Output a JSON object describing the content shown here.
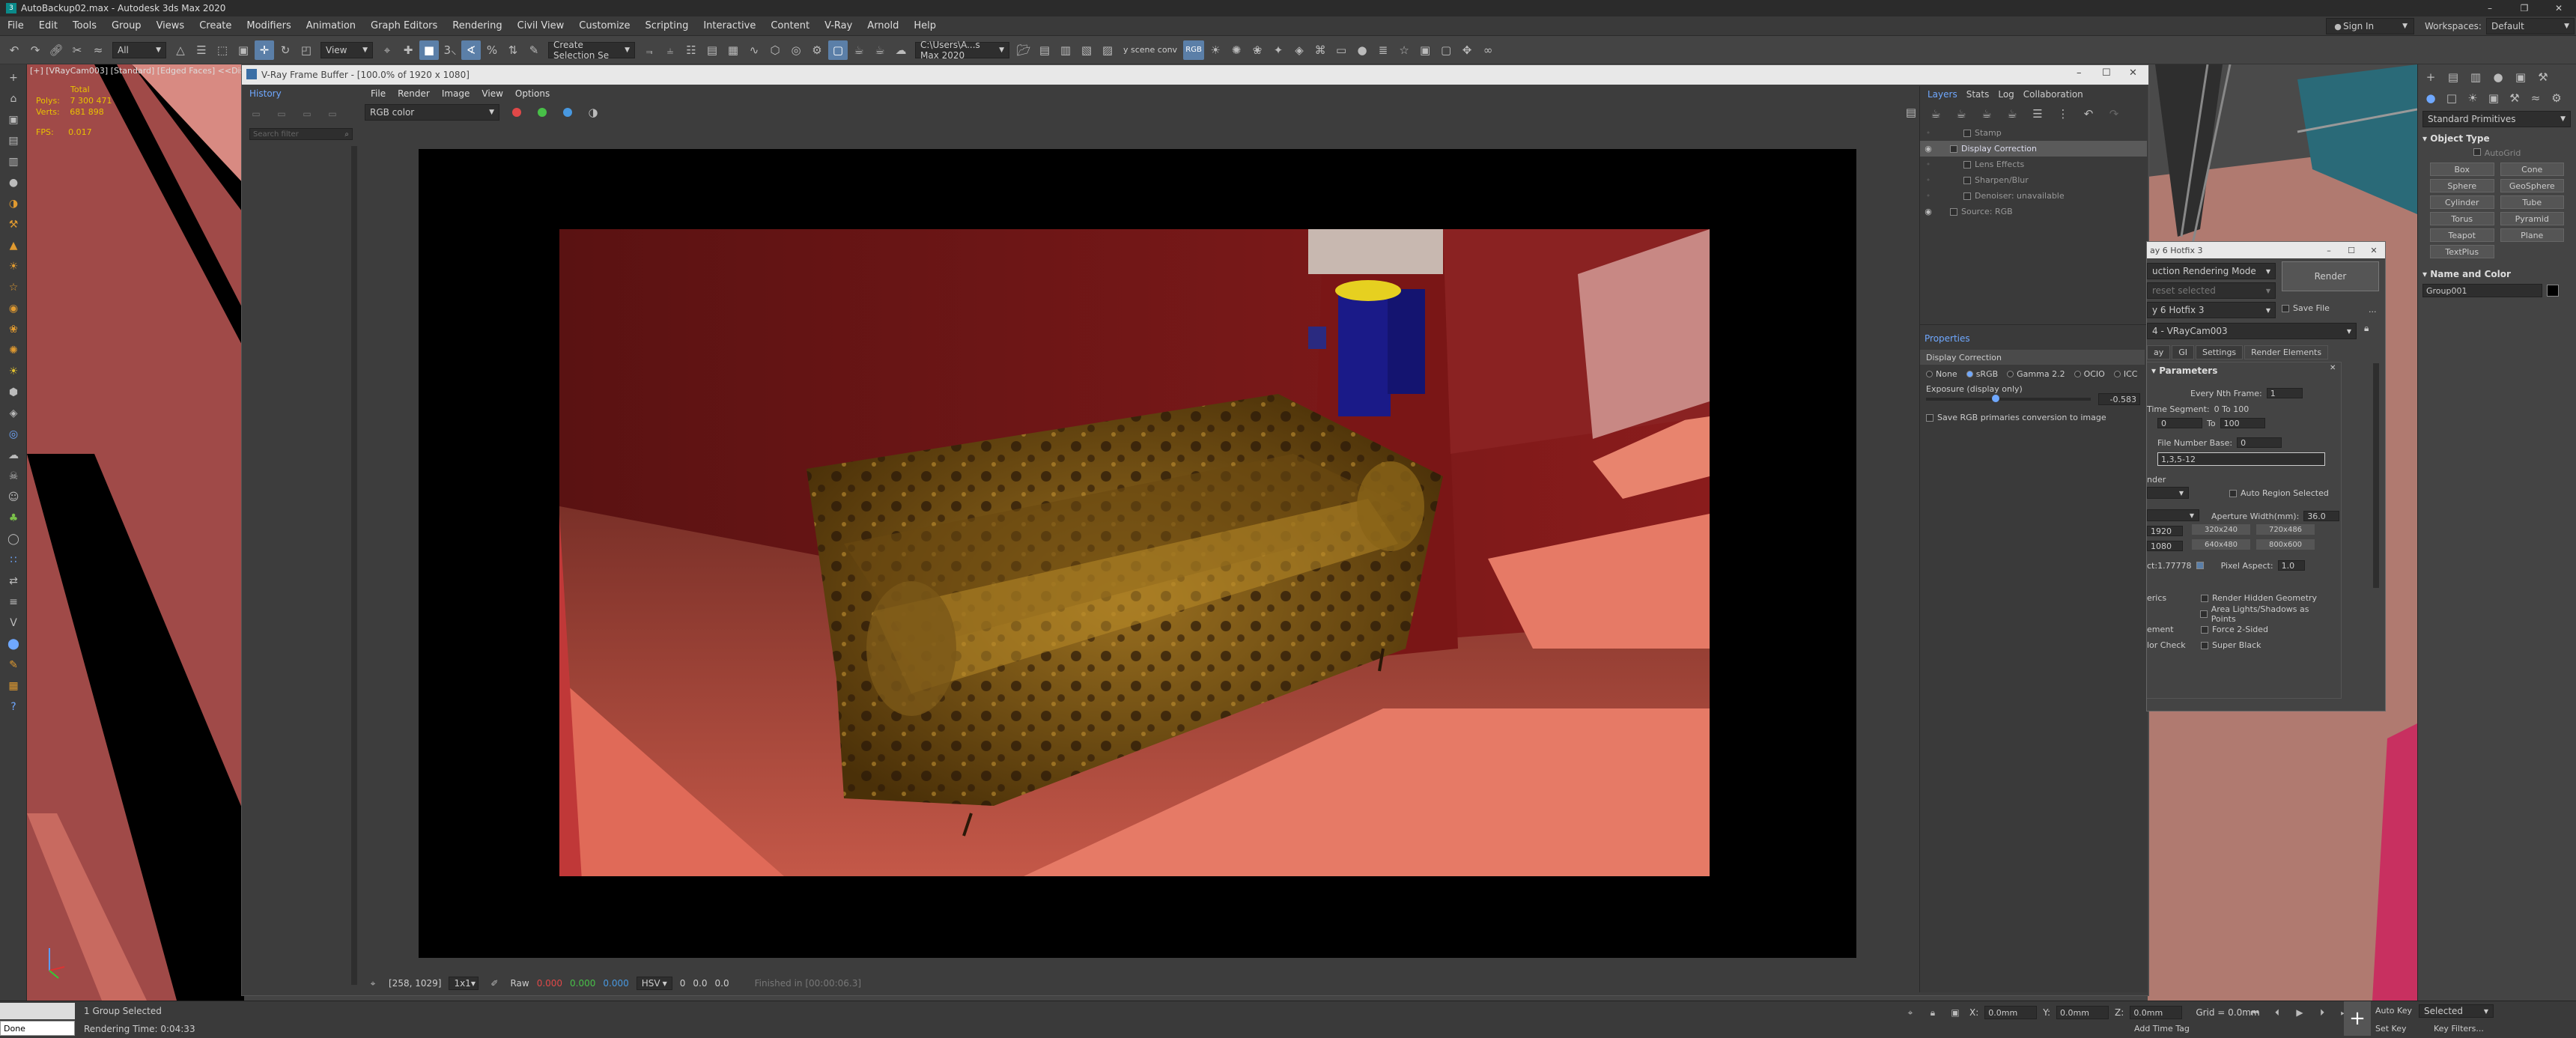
{
  "app": {
    "title": "AutoBackup02.max - Autodesk 3ds Max 2020",
    "sign_in": "Sign In",
    "workspaces_label": "Workspaces:",
    "workspace_value": "Default"
  },
  "menu": [
    "File",
    "Edit",
    "Tools",
    "Group",
    "Views",
    "Create",
    "Modifiers",
    "Animation",
    "Graph Editors",
    "Rendering",
    "Civil View",
    "Customize",
    "Scripting",
    "Interactive",
    "Content",
    "V-Ray",
    "Arnold",
    "Help"
  ],
  "toolbar": {
    "filter_select": "All",
    "view_select": "View",
    "selection_set": "Create Selection Se",
    "path": "C:\\Users\\A...s Max 2020",
    "scene_conv": "y scene conv",
    "rgb_label": "RGB"
  },
  "viewport": {
    "label": "[+] [VRayCam003] [Standard] [Edged Faces]  <<Disa",
    "stats": {
      "total_label": "Total",
      "polys_label": "Polys:",
      "polys_value": "7 300 471",
      "verts_label": "Verts:",
      "verts_value": "681 898",
      "fps_label": "FPS:",
      "fps_value": "0.017"
    }
  },
  "vfb": {
    "title": "V-Ray Frame Buffer - [100.0% of 1920 x 1080]",
    "history_label": "History",
    "history_search": "Search filter",
    "menu": [
      "File",
      "Render",
      "Image",
      "View",
      "Options"
    ],
    "channel_select": "RGB color",
    "status": {
      "coords": "[258, 1029]",
      "zoom": "1x1",
      "raw": "Raw",
      "r": "0.000",
      "g": "0.000",
      "b": "0.000",
      "mode": "HSV",
      "h": "0",
      "s": "0.0",
      "v": "0.0",
      "finished": "Finished in [00:00:06.3]"
    }
  },
  "layers": {
    "tabs": [
      "Layers",
      "Stats",
      "Log",
      "Collaboration"
    ],
    "rows": [
      {
        "name": "Stamp",
        "selected": false,
        "eye": false,
        "indent": 2
      },
      {
        "name": "Display Correction",
        "selected": true,
        "eye": true,
        "indent": 1
      },
      {
        "name": "Lens Effects",
        "selected": false,
        "eye": false,
        "indent": 2
      },
      {
        "name": "Sharpen/Blur",
        "selected": false,
        "eye": false,
        "indent": 2
      },
      {
        "name": "Denoiser: unavailable",
        "selected": false,
        "eye": false,
        "indent": 2
      },
      {
        "name": "Source: RGB",
        "selected": false,
        "eye": true,
        "indent": 1
      }
    ],
    "properties_label": "Properties",
    "display_correction_label": "Display Correction",
    "modes": [
      "None",
      "sRGB",
      "Gamma 2.2",
      "OCIO",
      "ICC"
    ],
    "exposure_label": "Exposure (display only)",
    "exposure_value": "-0.583",
    "save_rgb_label": "Save RGB primaries conversion to image"
  },
  "render_setup": {
    "title": "ay 6 Hotfix 3",
    "render_mode": "uction Rendering Mode",
    "preset": "reset selected",
    "renderer": "y 6 Hotfix 3",
    "view": "4 - VRayCam003",
    "render_button": "Render",
    "save_file": "Save File",
    "tabs": [
      "ay",
      "GI",
      "Settings",
      "Render Elements"
    ],
    "section": "Parameters",
    "every_nth_frame": "Every Nth Frame:",
    "every_nth_value": "1",
    "time_segment": "Time Segment:",
    "time_segment_value": "0 To 100",
    "range_from": "0",
    "to_label": "To",
    "range_to": "100",
    "file_number_base": "File Number Base:",
    "file_number_value": "0",
    "frames_value": "1,3,5-12",
    "area_label": "nder",
    "auto_region": "Auto Region Selected",
    "aperture_label": "Aperture Width(mm):",
    "aperture_value": "36.0",
    "width_value": "1920",
    "height_value": "1080",
    "presets": [
      "320x240",
      "720x486",
      "640x480",
      "800x600"
    ],
    "aspect_label": "ct:1.77778",
    "pixel_aspect_label": "Pixel Aspect:",
    "pixel_aspect_value": "1.0",
    "options": [
      {
        "left": "erics",
        "right": "Render Hidden Geometry"
      },
      {
        "left": "",
        "right": "Area Lights/Shadows as Points"
      },
      {
        "left": "ement",
        "right": "Force 2-Sided"
      },
      {
        "left": "lor Check",
        "right": "Super Black"
      }
    ]
  },
  "command_panel": {
    "category": "Standard Primitives",
    "object_type_label": "Object Type",
    "autogrid": "AutoGrid",
    "buttons": [
      "Box",
      "Cone",
      "Sphere",
      "GeoSphere",
      "Cylinder",
      "Tube",
      "Torus",
      "Pyramid",
      "Teapot",
      "Plane",
      "TextPlus"
    ],
    "name_color_label": "Name and Color",
    "name_value": "Group001"
  },
  "status_bar": {
    "selection": "1 Group Selected",
    "rendering_time": "Rendering Time: 0:04:33",
    "script_value": "Done",
    "x_label": "X:",
    "x_value": "0.0mm",
    "y_label": "Y:",
    "y_value": "0.0mm",
    "z_label": "Z:",
    "z_value": "0.0mm",
    "grid": "Grid = 0.0mm",
    "add_time_tag": "Add Time Tag",
    "auto_key": "Auto Key",
    "set_key": "Set Key",
    "key_mode": "Selected",
    "key_filters": "Key Filters..."
  },
  "colors": {
    "accent": "#5b7fa8",
    "highlight_text": "#6fa8ff",
    "stats_yellow": "#e8c200"
  }
}
